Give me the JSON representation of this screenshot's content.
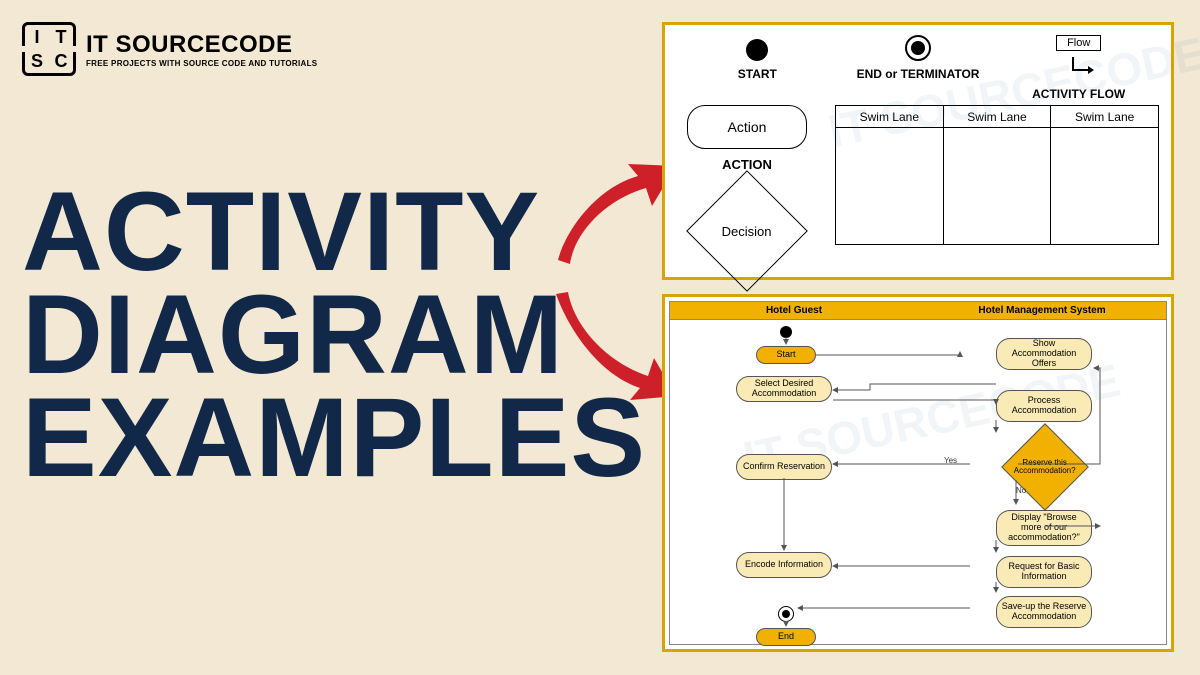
{
  "brand": {
    "mark": [
      "I",
      "T",
      "S",
      "C"
    ],
    "name": "IT SOURCECODE",
    "tagline": "FREE PROJECTS WITH SOURCE CODE AND TUTORIALS"
  },
  "headline": {
    "line1": "ACTIVITY",
    "line2": "DIAGRAM",
    "line3": "EXAMPLES"
  },
  "legend": {
    "start_label": "START",
    "end_label": "END or TERMINATOR",
    "flow_box": "Flow",
    "flow_label": "ACTIVITY FLOW",
    "action_text": "Action",
    "action_label": "ACTION",
    "decision_text": "Decision",
    "swimlanes": [
      "Swim Lane",
      "Swim Lane",
      "Swim Lane"
    ]
  },
  "example": {
    "lanes": [
      "Hotel Guest",
      "Hotel Management System"
    ],
    "left": {
      "start": "Start",
      "select": "Select  Desired Accommodation",
      "confirm": "Confirm Reservation",
      "encode": "Encode Information",
      "end": "End"
    },
    "right": {
      "show": "Show Accommodation Offers",
      "process": "Process Accommodation",
      "reserve_q": "Reserve this Accommodation?",
      "browse_q": "Display \"Browse more of our accommodation?\"",
      "request": "Request for Basic Information",
      "save": "Save-up the Reserve Accommodation"
    },
    "edge_yes": "Yes",
    "edge_no": "No"
  }
}
